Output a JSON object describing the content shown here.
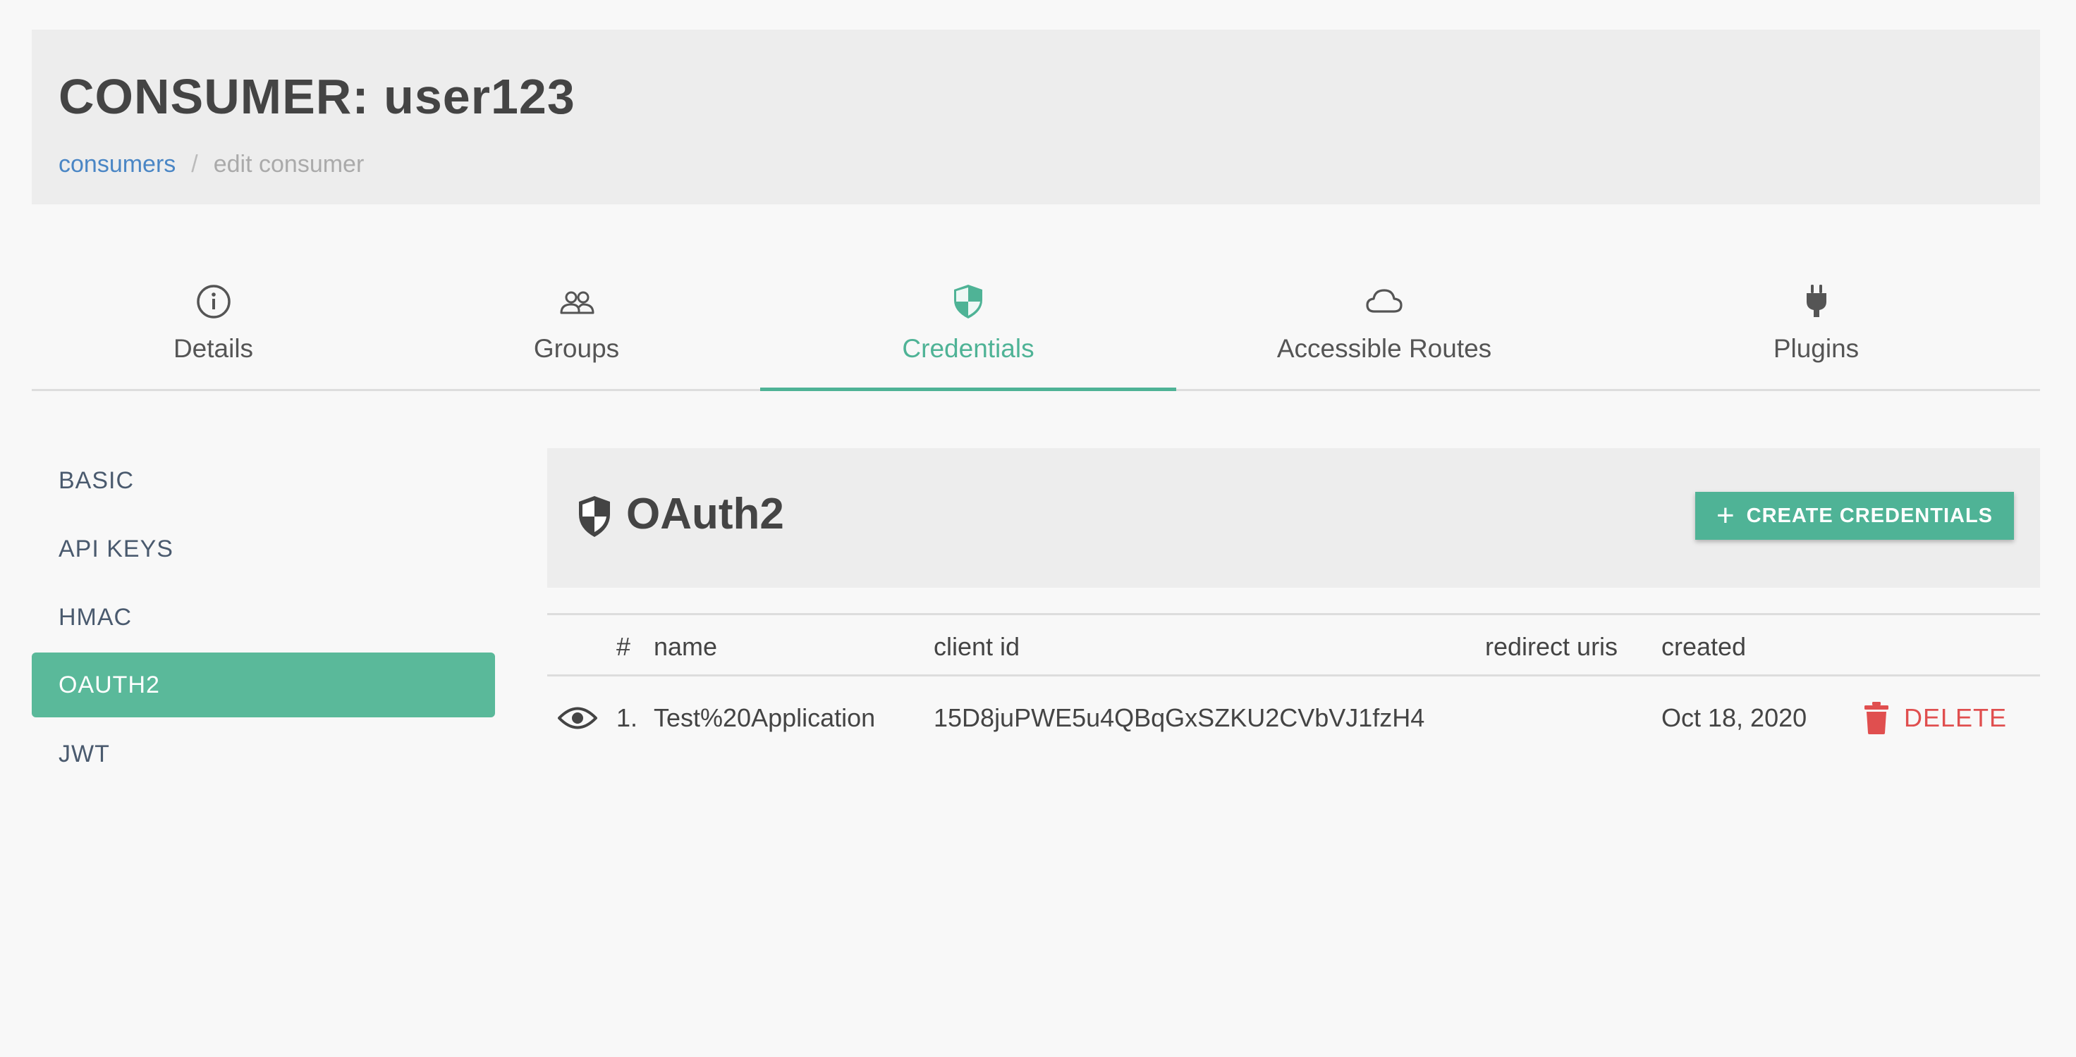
{
  "header": {
    "title": "CONSUMER: user123",
    "breadcrumb": {
      "link": "consumers",
      "separator": "/",
      "current": "edit consumer"
    }
  },
  "tabs": [
    {
      "label": "Details",
      "icon": "info-icon"
    },
    {
      "label": "Groups",
      "icon": "users-icon"
    },
    {
      "label": "Credentials",
      "icon": "shield-icon",
      "active": true
    },
    {
      "label": "Accessible Routes",
      "icon": "cloud-icon"
    },
    {
      "label": "Plugins",
      "icon": "plug-icon"
    }
  ],
  "sidebar": {
    "items": [
      {
        "label": "BASIC"
      },
      {
        "label": "API KEYS"
      },
      {
        "label": "HMAC"
      },
      {
        "label": "OAUTH2",
        "active": true
      },
      {
        "label": "JWT"
      }
    ]
  },
  "panel": {
    "title": "OAuth2",
    "icon": "shield-icon",
    "create_button": {
      "icon": "plus-icon",
      "label": "CREATE CREDENTIALS"
    }
  },
  "table": {
    "columns": {
      "index": "#",
      "name": "name",
      "client_id": "client id",
      "redirect_uris": "redirect uris",
      "created": "created"
    },
    "rows": [
      {
        "index": "1.",
        "name": "Test%20Application",
        "client_id": "15D8juPWE5u4QBqGxSZKU2CVbVJ1fzH4",
        "redirect_uris": "",
        "created": "Oct 18, 2020",
        "delete_label": "DELETE",
        "icons": [
          "eye-icon",
          "trash-icon"
        ]
      }
    ]
  },
  "colors": {
    "accent": "#4fb396",
    "sidebar_active": "#5ab99a",
    "link": "#4a86c5",
    "danger": "#e04f4f",
    "header_bg": "#ededed",
    "page_bg": "#f8f8f8"
  }
}
